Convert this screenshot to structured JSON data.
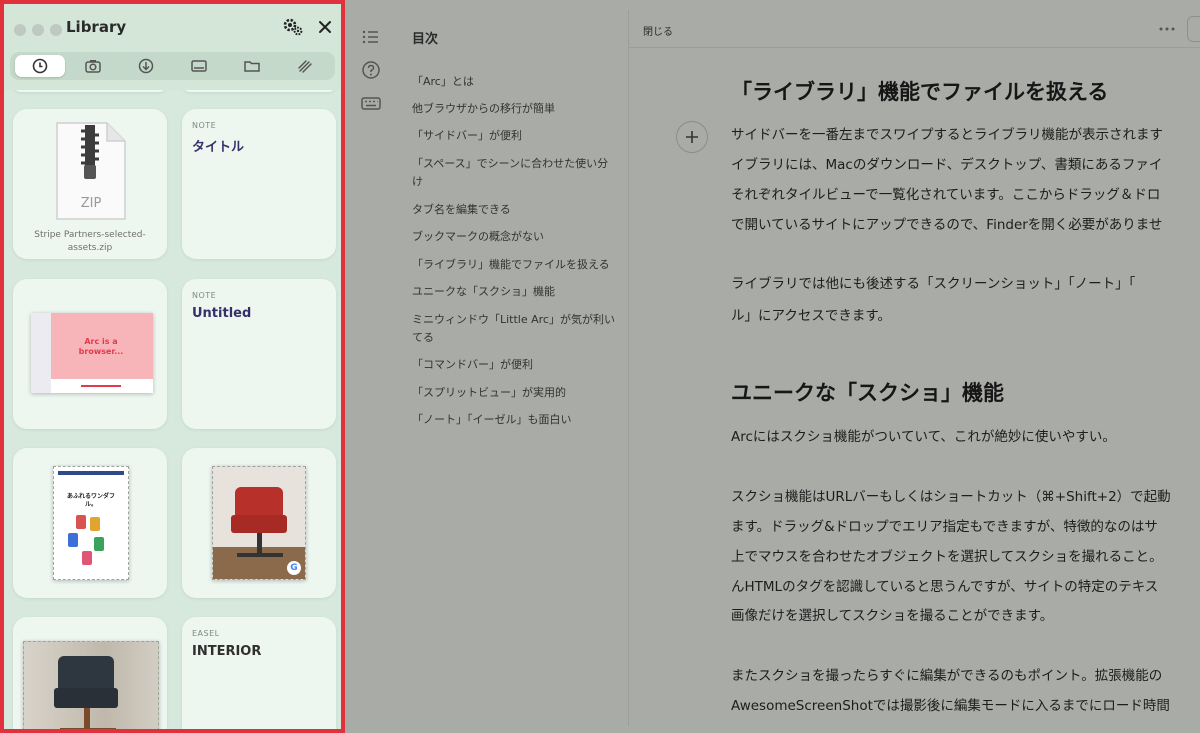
{
  "library": {
    "title": "Library",
    "tabs": [
      {
        "name": "recent-icon",
        "active": true
      },
      {
        "name": "camera-icon",
        "active": false
      },
      {
        "name": "download-icon",
        "active": false
      },
      {
        "name": "media-icon",
        "active": false
      },
      {
        "name": "folder-icon",
        "active": false
      },
      {
        "name": "easel-icon",
        "active": false
      }
    ],
    "cards": {
      "zip": {
        "badge": "ZIP",
        "caption_line1": "Stripe Partners-selected-",
        "caption_line2": "assets.zip"
      },
      "note1": {
        "type": "NOTE",
        "title": "タイトル"
      },
      "note2": {
        "type": "NOTE",
        "title": "Untitled"
      },
      "easel": {
        "type": "EASEL",
        "title": "INTERIOR"
      },
      "screenshot_text": "Arc is a browser...",
      "phone_text": "あふれるワンダフル。"
    }
  },
  "toc": {
    "title": "目次",
    "items": [
      "「Arc」とは",
      "他ブラウザからの移行が簡単",
      "「サイドバー」が便利",
      "「スペース」でシーンに合わせた使い分",
      "け",
      "タブ名を編集できる",
      "ブックマークの概念がない",
      "「ライブラリ」機能でファイルを扱える",
      "ユニークな「スクショ」機能",
      "ミニウィンドウ「Little Arc」が気が利い",
      "てる",
      "「コマンドバー」が便利",
      "「スプリットビュー」が実用的",
      "「ノート」「イーゼル」も面白い"
    ]
  },
  "doc": {
    "close_label": "閉じる",
    "section1_heading": "「ライブラリ」機能でファイルを扱える",
    "section1_lines": [
      "サイドバーを一番左までスワイプするとライブラリ機能が表示されます",
      "イブラリには、Macのダウンロード、デスクトップ、書類にあるファイ",
      "それぞれタイルビューで一覧化されています。ここからドラッグ＆ドロ",
      "で開いているサイトにアップできるので、Finderを開く必要がありませ"
    ],
    "section1_p2": [
      "ライブラリでは他にも後述する「スクリーンショット」「ノート」「",
      "ル」にアクセスできます。"
    ],
    "section2_heading": "ユニークな「スクショ」機能",
    "section2_p1": "Arcにはスクショ機能がついていて、これが絶妙に使いやすい。",
    "section2_p2": [
      "スクショ機能はURLバーもしくはショートカット（⌘+Shift+2）で起動",
      "ます。ドラッグ&ドロップでエリア指定もできますが、特徴的なのはサ",
      "上でマウスを合わせたオブジェクトを選択してスクショを撮れること。",
      "んHTMLのタグを認識していると思うんですが、サイトの特定のテキス",
      "画像だけを選択してスクショを撮ることができます。"
    ],
    "section2_p3": [
      "またスクショを撮ったらすぐに編集ができるのもポイント。拡張機能の",
      "AwesomeScreenShotでは撮影後に編集モードに入るまでにロード時間"
    ]
  },
  "colors": {
    "highlight_border": "#e0313c",
    "library_bg": "#d7e9dc",
    "note_title": "#34306a"
  }
}
